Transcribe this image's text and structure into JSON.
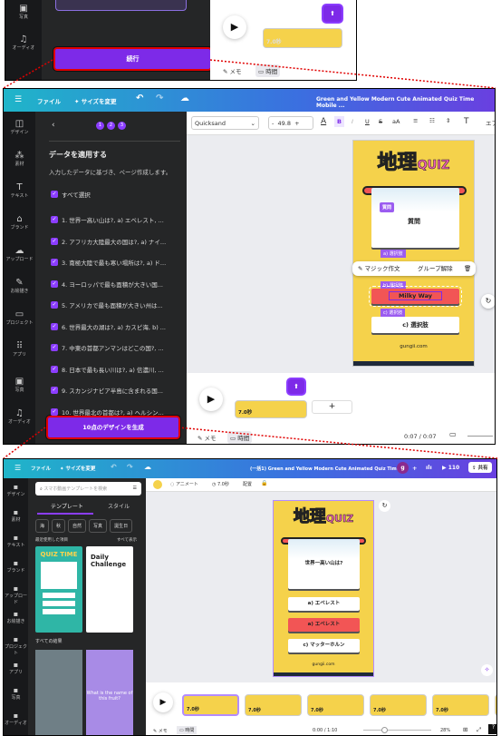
{
  "panel1": {
    "sidebar": [
      {
        "icon": "photo-icon",
        "label": "写真"
      },
      {
        "icon": "music-icon",
        "label": "オーディオ"
      }
    ],
    "continue_button": "続行",
    "duration": "7.0秒",
    "memo": "メモ",
    "time": "時間"
  },
  "panel2": {
    "topbar": {
      "file": "ファイル",
      "resize": "サイズを変更",
      "title": "Green and Yellow Modern Cute Animated Quiz Time Mobile ..."
    },
    "toolbar": {
      "font": "Quicksand",
      "minus": "-",
      "size": "49.8",
      "plus": "+",
      "bold": "B",
      "italic": "I",
      "underline": "U",
      "strike": "S",
      "case": "aA",
      "more": "エフ"
    },
    "sidebar": [
      {
        "icon": "design-icon",
        "label": "デザイン"
      },
      {
        "icon": "elements-icon",
        "label": "素材"
      },
      {
        "icon": "text-icon",
        "label": "テキスト"
      },
      {
        "icon": "brand-icon",
        "label": "ブランド"
      },
      {
        "icon": "upload-icon",
        "label": "アップロード"
      },
      {
        "icon": "draw-icon",
        "label": "お絵描き"
      },
      {
        "icon": "folder-icon",
        "label": "プロジェクト"
      },
      {
        "icon": "apps-icon",
        "label": "アプリ"
      },
      {
        "icon": "photo-icon",
        "label": "写真"
      },
      {
        "icon": "music-icon",
        "label": "オーディオ"
      }
    ],
    "steps": [
      "1",
      "2",
      "3"
    ],
    "heading": "データを適用する",
    "subtext": "入力したデータに基づき、ページ作成します。",
    "select_all": "すべて選択",
    "items": [
      "1. 世界一高い山は?, a) エベレスト, ...",
      "2. アフリカ大陸最大の国は?, a) ナイ...",
      "3. 南極大陸で最も寒い場所は?, a) ド...",
      "4. ヨーロッパで最も面積が大きい国...",
      "5. アメリカで最も面積が大きい州は...",
      "6. 世界最大の湖は?, a) カスピ海, b) ...",
      "7. 中東の首都アンマンはどこの国?, ...",
      "8. 日本で最も長い川は?, a) 信濃川, ...",
      "9. スカンジナビア半島に含まれる国...",
      "10. 世界最北の首都は?, a) ヘルシン..."
    ],
    "generate_button": "10点のデザインを生成",
    "canvas": {
      "title_kanji": "地理",
      "title_quiz": "QUIZ",
      "question_tag": "質問",
      "question": "質問",
      "option_tag_a": "a) 選択肢",
      "option_tag_b": "b) 選択肢",
      "option_tag_c": "c) 選択肢",
      "selected_option": "Milky Way",
      "option_c": "c) 選択肢",
      "site": "gungii.com",
      "magic_write": "マジック作文",
      "ungroup": "グループ解除"
    },
    "timeline": {
      "duration": "7.0秒",
      "time": "0:07 / 0:07",
      "memo": "メモ",
      "time_tab": "時間"
    }
  },
  "panel3": {
    "topbar": {
      "file": "ファイル",
      "resize": "サイズを変更",
      "title": "(一括1) Green and Yellow Modern Cute Animated Quiz Time ...",
      "avatar": "g",
      "plus": "+",
      "play_count": "110",
      "share": "共有"
    },
    "toolbar": {
      "animate": "アニメート",
      "duration": "7.0秒",
      "position": "配置"
    },
    "search_placeholder": "スマホ動画テンプレートを検索",
    "tabs": [
      "テンプレート",
      "スタイル"
    ],
    "chips": [
      "海",
      "秋",
      "自然",
      "写真",
      "誕生日"
    ],
    "recent": "最近使用した項目",
    "see_all": "すべて表示",
    "all_results": "すべての結果",
    "sidebar": [
      {
        "icon": "design-icon",
        "label": "デザイン"
      },
      {
        "icon": "elements-icon",
        "label": "素材"
      },
      {
        "icon": "text-icon",
        "label": "テキスト"
      },
      {
        "icon": "brand-icon",
        "label": "ブランド"
      },
      {
        "icon": "upload-icon",
        "label": "アップロード"
      },
      {
        "icon": "draw-icon",
        "label": "お絵描き"
      },
      {
        "icon": "folder-icon",
        "label": "プロジェクト"
      },
      {
        "icon": "apps-icon",
        "label": "アプリ"
      },
      {
        "icon": "photo-icon",
        "label": "写真"
      },
      {
        "icon": "music-icon",
        "label": "オーディオ"
      }
    ],
    "templates": {
      "quiz_time": "QUIZ TIME",
      "daily": "Daily Challenge",
      "fruit": "What is the name of this fruit?"
    },
    "canvas": {
      "title_kanji": "地理",
      "title_quiz": "QUIZ",
      "question": "世界一高い山は?",
      "option_a": "a) エベレスト",
      "option_b": "a) エベレスト",
      "option_c": "c) マッターホルン",
      "site": "gungii.com"
    },
    "timeline": {
      "duration": "7.0秒",
      "time": "0:00 / 1:10",
      "zoom": "28%",
      "memo": "メモ",
      "time_tab": "時間"
    }
  },
  "colors": {
    "accent": "#7d2ae8",
    "highlight": "#e00000",
    "card": "#f5d24b",
    "wrong": "#f25555"
  }
}
